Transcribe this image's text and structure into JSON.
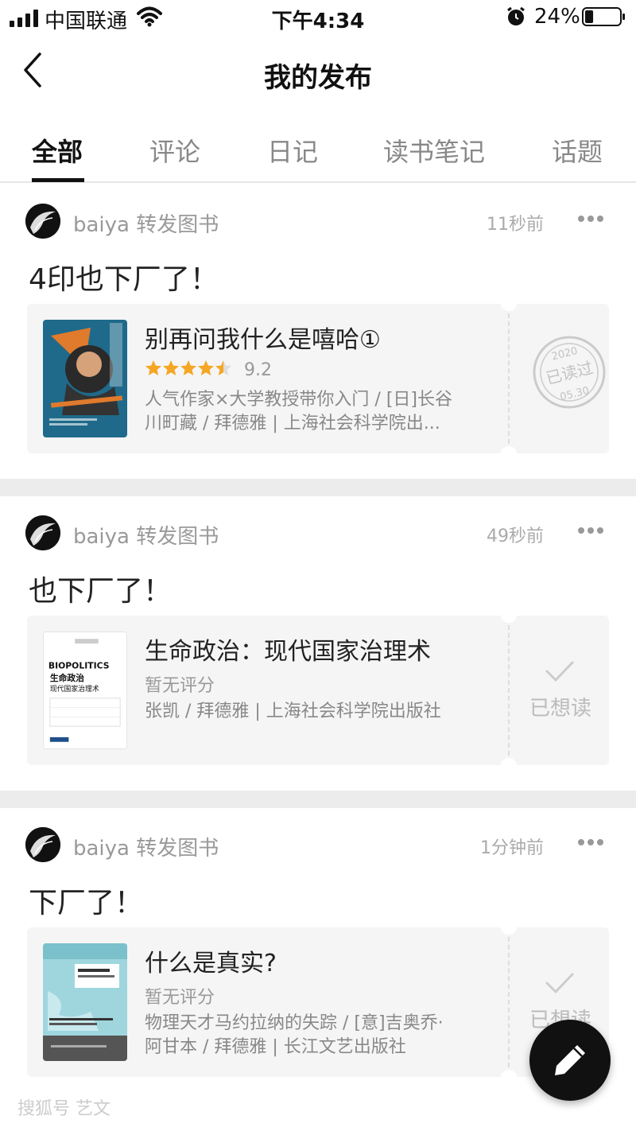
{
  "status_bar": {
    "carrier": "中国联通",
    "time": "下午4:34",
    "battery_percent": "24%",
    "battery_level": 0.24
  },
  "nav": {
    "title": "我的发布"
  },
  "tabs": [
    {
      "label": "全部",
      "active": true
    },
    {
      "label": "评论",
      "active": false
    },
    {
      "label": "日记",
      "active": false
    },
    {
      "label": "读书笔记",
      "active": false
    },
    {
      "label": "话题",
      "active": false
    }
  ],
  "posts": [
    {
      "user": "baiya",
      "action": "转发图书",
      "time": "11秒前",
      "text": "4印也下厂了！",
      "book": {
        "title": "别再问我什么是嘻哈①",
        "rating_stars": 4.5,
        "rating_value": "9.2",
        "meta_line1": "人气作家×大学教授带你入门 / [日]长谷",
        "meta_line2": "川町藏 / 拜德雅 | 上海社会科学院出...",
        "status": "已读过",
        "stamp": {
          "year": "2020",
          "label": "已读过",
          "date": "05.30"
        }
      }
    },
    {
      "user": "baiya",
      "action": "转发图书",
      "time": "49秒前",
      "text": "也下厂了！",
      "book": {
        "title": "生命政治：现代国家治理术",
        "rating_text": "暂无评分",
        "meta_line1": "张凯 / 拜德雅 | 上海社会科学院出版社",
        "meta_line2": "",
        "status": "已想读",
        "cover_text_en": "BIOPOLITICS",
        "cover_text_cn1": "生命政治",
        "cover_text_cn2": "现代国家治理术"
      }
    },
    {
      "user": "baiya",
      "action": "转发图书",
      "time": "1分钟前",
      "text": "下厂了！",
      "book": {
        "title": "什么是真实?",
        "rating_text": "暂无评分",
        "meta_line1": "物理天才马约拉纳的失踪 / [意]吉奥乔·",
        "meta_line2": "阿甘本 / 拜德雅 | 长江文艺出版社",
        "status": "已想读"
      }
    }
  ],
  "watermark": "搜狐号 艺文",
  "colors": {
    "star": "#f5a623",
    "gap": "#ececec",
    "card_bg": "#f5f5f5"
  }
}
